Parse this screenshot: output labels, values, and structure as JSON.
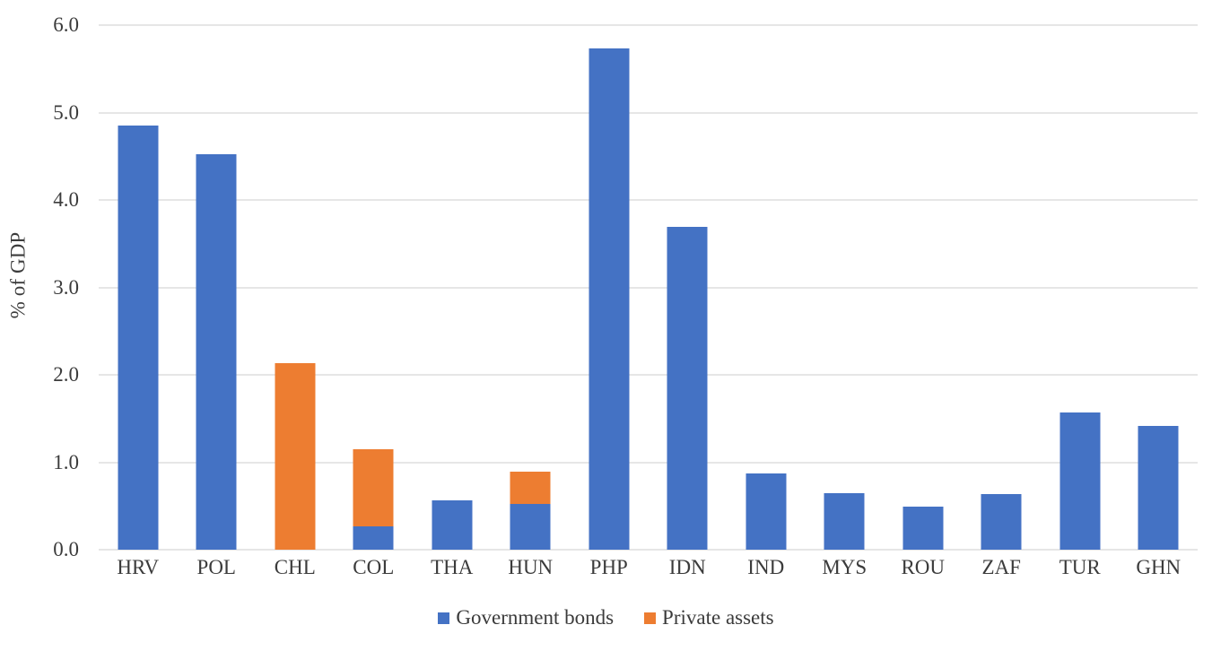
{
  "chart_data": {
    "type": "bar",
    "subtype": "stacked-column",
    "title": "",
    "xlabel": "",
    "ylabel": "% of GDP",
    "ylim": [
      0.0,
      6.0
    ],
    "ytick_step": 1.0,
    "ytick_labels": [
      "6.0",
      "5.0",
      "4.0",
      "3.0",
      "2.0",
      "1.0",
      "0.0"
    ],
    "ytick_values": [
      6.0,
      5.0,
      4.0,
      3.0,
      2.0,
      1.0,
      0.0
    ],
    "grid": true,
    "grid_axis": "y",
    "legend_position": "bottom",
    "categories": [
      "HRV",
      "POL",
      "CHL",
      "COL",
      "THA",
      "HUN",
      "PHP",
      "IDN",
      "IND",
      "MYS",
      "ROU",
      "ZAF",
      "TUR",
      "GHN"
    ],
    "series": [
      {
        "name": "Government bonds",
        "color": "#4472C4",
        "values": [
          4.85,
          4.52,
          0.0,
          0.27,
          0.56,
          0.52,
          5.73,
          3.69,
          0.87,
          0.65,
          0.49,
          0.64,
          1.57,
          1.42
        ]
      },
      {
        "name": "Private assets",
        "color": "#ED7D31",
        "values": [
          0.0,
          0.0,
          2.13,
          0.88,
          0.0,
          0.37,
          0.0,
          0.0,
          0.0,
          0.0,
          0.0,
          0.0,
          0.0,
          0.0
        ]
      }
    ],
    "totals": [
      4.85,
      4.52,
      2.13,
      1.15,
      0.56,
      0.89,
      5.73,
      3.69,
      0.87,
      0.65,
      0.49,
      0.64,
      1.57,
      1.42
    ]
  },
  "colors": {
    "government_bonds": "#4472C4",
    "private_assets": "#ED7D31",
    "gridline": "#E6E6E6",
    "text": "#3B3B3B",
    "background": "#FFFFFF"
  }
}
